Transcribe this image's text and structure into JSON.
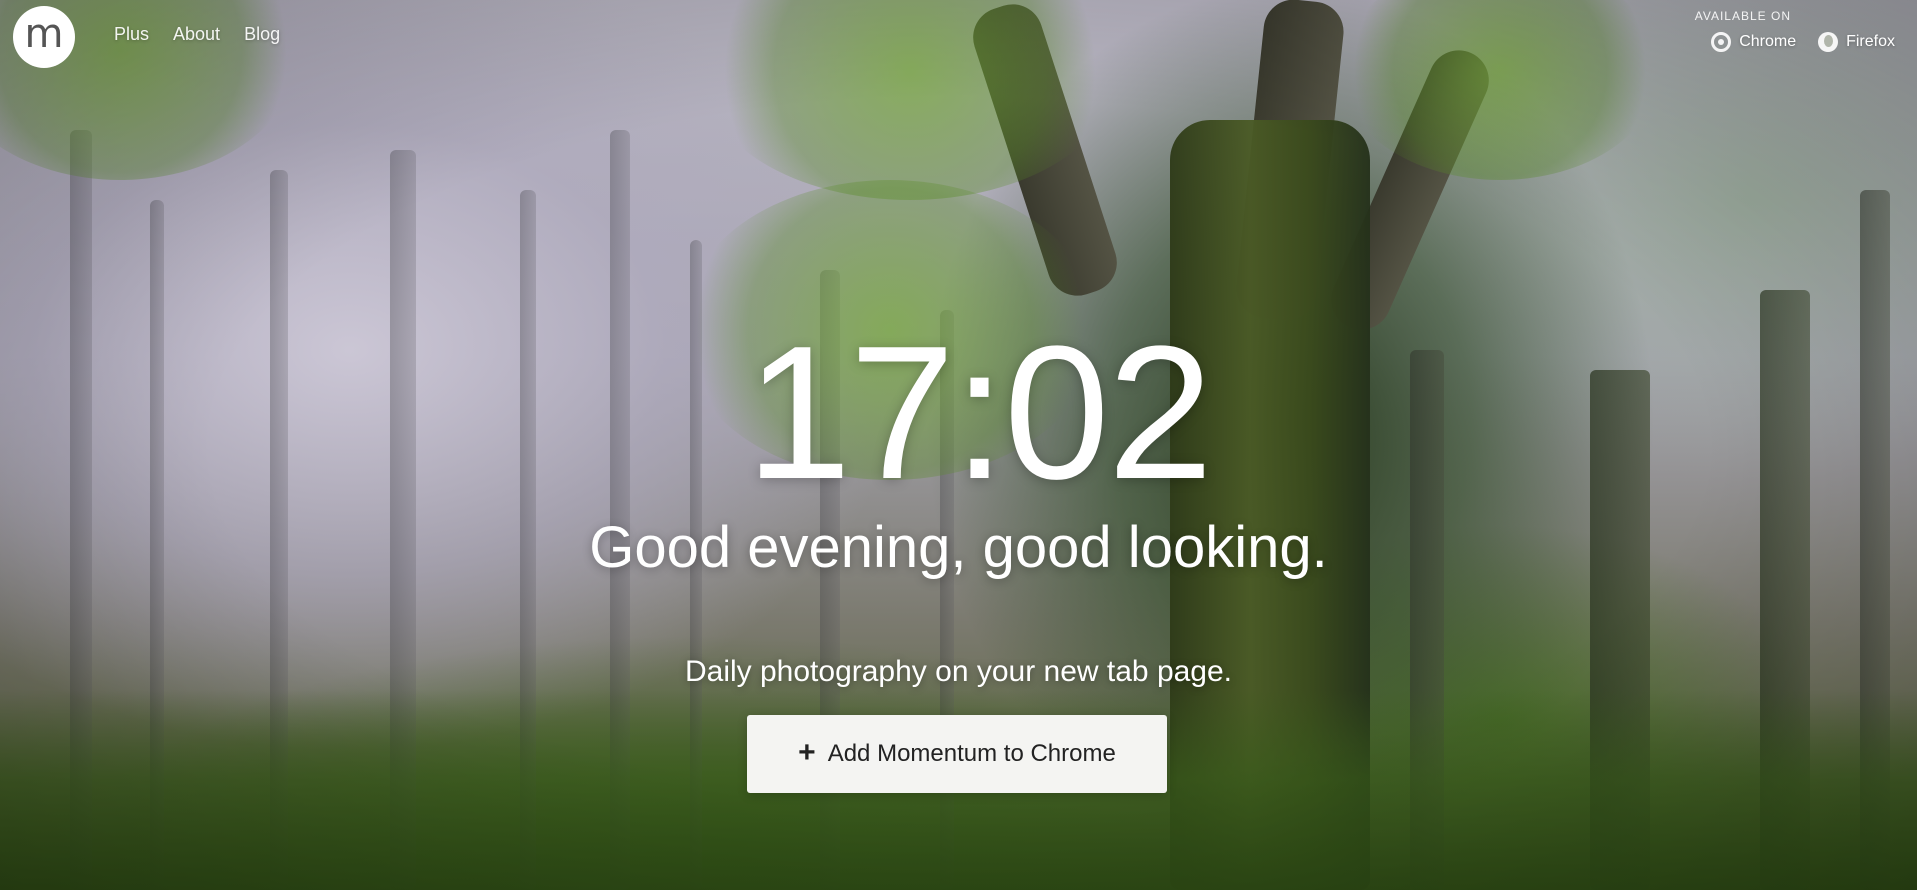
{
  "brand": {
    "logo_letter": "m"
  },
  "nav": {
    "items": [
      {
        "label": "Plus"
      },
      {
        "label": "About"
      },
      {
        "label": "Blog"
      }
    ]
  },
  "availability": {
    "heading": "AVAILABLE ON",
    "browsers": [
      {
        "label": "Chrome",
        "icon": "chrome-icon"
      },
      {
        "label": "Firefox",
        "icon": "firefox-icon"
      }
    ]
  },
  "hero": {
    "time": "17:02",
    "greeting": "Good evening, good looking.",
    "tagline": "Daily photography on your new tab page."
  },
  "cta": {
    "icon": "plus-icon",
    "label": "Add Momentum to Chrome"
  },
  "colors": {
    "cta_background": "#f4f4f2",
    "text": "#ffffff"
  }
}
